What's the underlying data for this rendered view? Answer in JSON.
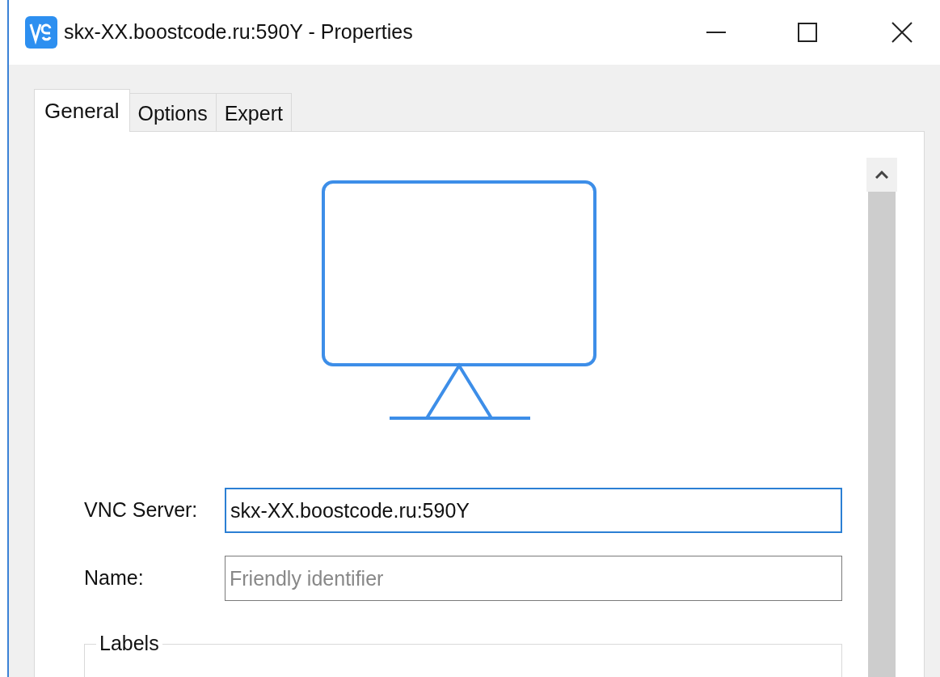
{
  "window": {
    "title": "skx-XX.boostcode.ru:590Y - Properties"
  },
  "tabs": [
    {
      "label": "General",
      "selected": true
    },
    {
      "label": "Options",
      "selected": false
    },
    {
      "label": "Expert",
      "selected": false
    }
  ],
  "fields": [
    {
      "label": "VNC Server:",
      "value": "skx-XX.boostcode.ru:590Y",
      "focused": true
    },
    {
      "label": "Name:",
      "placeholder": "Friendly identifier",
      "focused": false
    }
  ],
  "groups": [
    {
      "title": "Labels"
    }
  ]
}
